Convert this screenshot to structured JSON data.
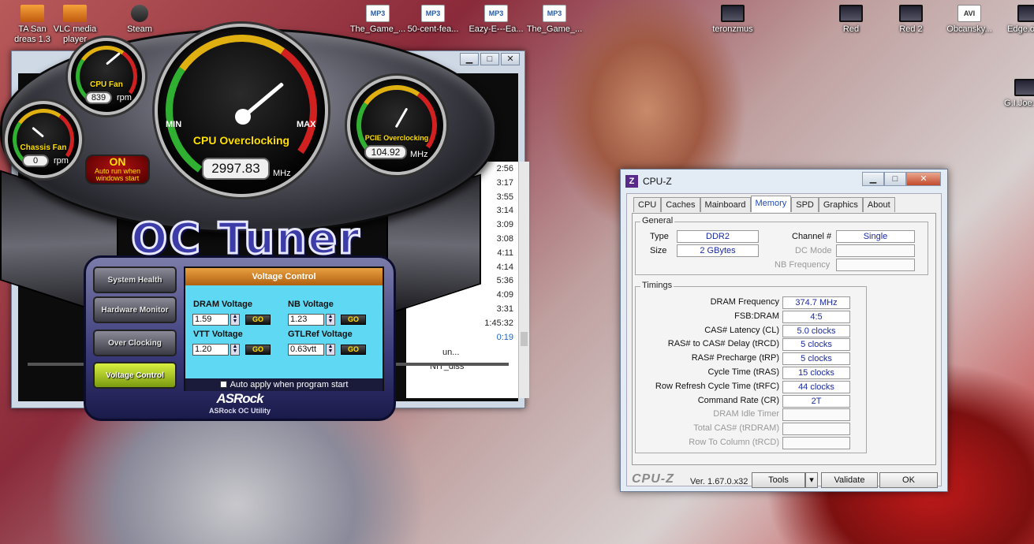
{
  "desktop": {
    "icons": [
      {
        "label": "TA San\ndreas 1.3",
        "type": "app"
      },
      {
        "label": "VLC media\nplayer",
        "type": "app"
      },
      {
        "label": "Steam",
        "type": "steam"
      },
      {
        "label": "The_Game_...",
        "type": "mp3",
        "badge": "MP3"
      },
      {
        "label": "50-cent-fea...",
        "type": "mp3",
        "badge": "MP3"
      },
      {
        "label": "Eazy-E---Ea...",
        "type": "mp3",
        "badge": "MP3"
      },
      {
        "label": "The_Game_...",
        "type": "mp3",
        "badge": "MP3"
      },
      {
        "label": "teronzmus",
        "type": "vid"
      },
      {
        "label": "Red",
        "type": "vid"
      },
      {
        "label": "Red 2",
        "type": "vid"
      },
      {
        "label": "Obcansky...",
        "type": "avi",
        "badge": "AVI"
      },
      {
        "label": "Edge.of.T...",
        "type": "vid"
      },
      {
        "label": "G.I.Joe.R...",
        "type": "vid"
      }
    ]
  },
  "player": {
    "times": [
      "2:56",
      "3:17",
      "3:55",
      "3:14",
      "3:09",
      "3:08",
      "4:11",
      "4:14",
      "5:36",
      "4:09",
      "3:31",
      "1:45:32",
      "0:19"
    ],
    "highlight_index": 12,
    "title_fragments": [
      "un...",
      "NIT_diss"
    ],
    "buttons": {
      "minimize": "▁",
      "maximize": "□",
      "close": "✕"
    }
  },
  "octuner": {
    "cpu_fan": {
      "title": "CPU Fan",
      "value": "839",
      "unit": "rpm"
    },
    "chassis_fan": {
      "title": "Chassis Fan",
      "value": "0",
      "unit": "rpm"
    },
    "cpu_oc": {
      "title": "CPU Overclocking",
      "value": "2997.83",
      "unit": "MHz",
      "min_label": "MIN",
      "max_label": "MAX"
    },
    "pcie_oc": {
      "title": "PCIE Overclocking",
      "value": "104.92",
      "unit": "MHz"
    },
    "autorun": {
      "state": "ON",
      "line1": "Auto run when",
      "line2": "windows start"
    },
    "logo": "OC Tuner",
    "nav": [
      {
        "label": "System Health",
        "active": false
      },
      {
        "label": "Hardware Monitor",
        "active": false
      },
      {
        "label": "Over Clocking",
        "active": false
      },
      {
        "label": "Voltage Control",
        "active": true
      }
    ],
    "voltage_panel": {
      "title": "Voltage Control",
      "go_label": "GO",
      "fields": [
        {
          "label": "DRAM Voltage",
          "value": "1.59"
        },
        {
          "label": "NB Voltage",
          "value": "1.23"
        },
        {
          "label": "VTT Voltage",
          "value": "1.20"
        },
        {
          "label": "GTLRef Voltage",
          "value": "0.63vtt"
        }
      ],
      "auto_apply": "Auto apply when program start"
    },
    "brand": "ASRock",
    "brand_sub": "ASRock OC Utility"
  },
  "cpuz": {
    "title": "CPU-Z",
    "tabs": [
      "CPU",
      "Caches",
      "Mainboard",
      "Memory",
      "SPD",
      "Graphics",
      "About"
    ],
    "active_tab": "Memory",
    "general": {
      "title": "General",
      "type_label": "Type",
      "type_value": "DDR2",
      "size_label": "Size",
      "size_value": "2 GBytes",
      "channel_label": "Channel #",
      "channel_value": "Single",
      "dcmode_label": "DC Mode",
      "dcmode_value": "",
      "nbfreq_label": "NB Frequency",
      "nbfreq_value": ""
    },
    "timings": {
      "title": "Timings",
      "rows": [
        {
          "label": "DRAM Frequency",
          "value": "374.7 MHz",
          "dim": false
        },
        {
          "label": "FSB:DRAM",
          "value": "4:5",
          "dim": false
        },
        {
          "label": "CAS# Latency (CL)",
          "value": "5.0 clocks",
          "dim": false
        },
        {
          "label": "RAS# to CAS# Delay (tRCD)",
          "value": "5 clocks",
          "dim": false
        },
        {
          "label": "RAS# Precharge (tRP)",
          "value": "5 clocks",
          "dim": false
        },
        {
          "label": "Cycle Time (tRAS)",
          "value": "15 clocks",
          "dim": false
        },
        {
          "label": "Row Refresh Cycle Time (tRFC)",
          "value": "44 clocks",
          "dim": false
        },
        {
          "label": "Command Rate (CR)",
          "value": "2T",
          "dim": false
        },
        {
          "label": "DRAM Idle Timer",
          "value": "",
          "dim": true
        },
        {
          "label": "Total CAS# (tRDRAM)",
          "value": "",
          "dim": true
        },
        {
          "label": "Row To Column (tRCD)",
          "value": "",
          "dim": true
        }
      ]
    },
    "footer": {
      "brand": "CPU-Z",
      "version": "Ver. 1.67.0.x32",
      "tools": "Tools",
      "validate": "Validate",
      "ok": "OK"
    },
    "buttons": {
      "minimize": "▁",
      "maximize": "□",
      "close": "✕"
    }
  }
}
